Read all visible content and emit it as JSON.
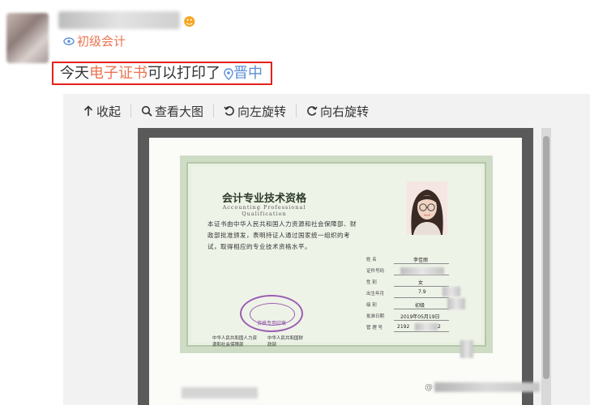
{
  "post": {
    "author_avatar_icon": "user-avatar",
    "badge_icon": "vip-emoji-icon",
    "topic_tag": "初级会计",
    "text_plain": "今天",
    "text_link": "电子证书",
    "text_rest": "可以打印了",
    "location": "晋中",
    "highlight_color": "#e5211d"
  },
  "toolbar": {
    "collapse_label": "收起",
    "view_large_label": "查看大图",
    "rotate_left_label": "向左旋转",
    "rotate_right_label": "向右旋转"
  },
  "certificate": {
    "title": "会计专业技术资格",
    "subtitle": "Accounting Professional Qualification",
    "body": "本证书由中华人民共和国人力资源和社会保障部、财政部批准颁发，表明持证人通过国家统一组织的考试，取得相应的专业技术资格水平。",
    "seal_text": "资格专用印章",
    "issuer_left": "中华人民共和国人力资源和社会保障部",
    "issuer_right": "中华人民共和国财政部",
    "fields": [
      {
        "label": "姓    名",
        "value": "李佳丽"
      },
      {
        "label": "证件号码",
        "value": ""
      },
      {
        "label": "性    别",
        "value": "女"
      },
      {
        "label": "出生年月",
        "value": "7.9"
      },
      {
        "label": "级    别",
        "value": "初级"
      },
      {
        "label": "批准日期",
        "value": "2019年05月19日"
      },
      {
        "label": "管 理 号",
        "value": "2192"
      }
    ]
  },
  "watermark": "@"
}
